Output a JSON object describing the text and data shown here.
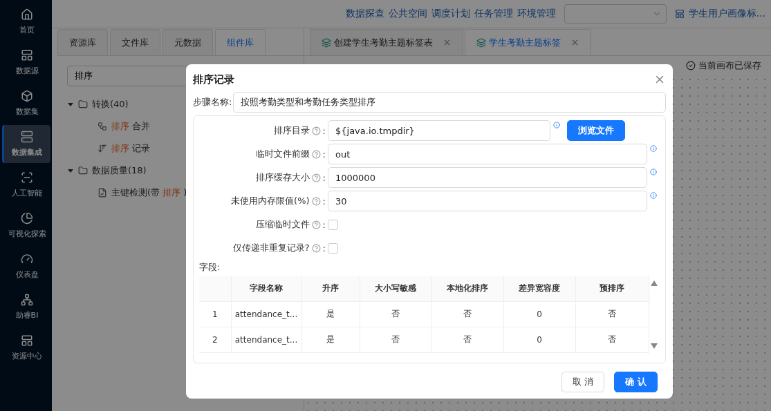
{
  "sidebar": {
    "items": [
      {
        "label": "首页",
        "selected": false
      },
      {
        "label": "数据源",
        "selected": false
      },
      {
        "label": "数据集",
        "selected": false
      },
      {
        "label": "数据集成",
        "selected": true
      },
      {
        "label": "人工智能",
        "selected": false
      },
      {
        "label": "可视化探索",
        "selected": false
      },
      {
        "label": "仪表盘",
        "selected": false
      },
      {
        "label": "助睿BI",
        "selected": false
      },
      {
        "label": "资源中心",
        "selected": false
      }
    ]
  },
  "header": {
    "links": [
      "数据探查",
      "公共空间",
      "调度计划",
      "任务管理",
      "环境管理"
    ],
    "project": "学生用户画像标..."
  },
  "left_panel": {
    "tabs": [
      {
        "label": "资源库",
        "selected": false
      },
      {
        "label": "文件库",
        "selected": false
      },
      {
        "label": "元数据",
        "selected": false
      },
      {
        "label": "组件库",
        "selected": true
      }
    ],
    "search": {
      "value": "排序"
    },
    "tree": [
      {
        "label": "转换(40)",
        "expanded": true,
        "children": [
          {
            "segments": [
              {
                "text": "排序",
                "highlight": true
              },
              {
                "text": " 合并",
                "highlight": false
              }
            ]
          },
          {
            "segments": [
              {
                "text": "排序",
                "highlight": true
              },
              {
                "text": " 记录",
                "highlight": false
              }
            ]
          }
        ]
      },
      {
        "label": "数据质量(18)",
        "expanded": true,
        "children": [
          {
            "segments": [
              {
                "text": "主键检测(带 ",
                "highlight": false
              },
              {
                "text": "排序",
                "highlight": true
              },
              {
                "text": " )",
                "highlight": false
              }
            ]
          }
        ]
      }
    ]
  },
  "editor_tabs": [
    {
      "label": "创建学生考勤主题标签表",
      "selected": false
    },
    {
      "label": "学生考勤主题标签",
      "selected": true
    }
  ],
  "save_status": "当前画布已保存",
  "dialog": {
    "title": "排序记录",
    "step_name": {
      "label": "步骤名称:",
      "value": "按照考勤类型和考勤任务类型排序"
    },
    "separator": ":",
    "fields": [
      {
        "kind": "text",
        "label": "排序目录",
        "value": "${java.io.tmpdir}",
        "button": "浏览文件"
      },
      {
        "kind": "text",
        "label": "临时文件前缀",
        "value": "out"
      },
      {
        "kind": "text",
        "label": "排序缓存大小",
        "value": "1000000"
      },
      {
        "kind": "text",
        "label": "未使用内存限值(%)",
        "value": "30"
      },
      {
        "kind": "checkbox",
        "label": "压缩临时文件",
        "checked": false
      },
      {
        "kind": "checkbox",
        "label": "仅传递非重复记录?",
        "checked": false
      }
    ],
    "fields_label": "字段:",
    "table": {
      "columns": [
        "",
        "字段名称",
        "升序",
        "大小写敏感",
        "本地化排序",
        "差异宽容度",
        "预排序"
      ],
      "rows": [
        [
          "1",
          "attendance_t...",
          "是",
          "否",
          "否",
          "0",
          "否"
        ],
        [
          "2",
          "attendance_t...",
          "是",
          "否",
          "否",
          "0",
          "否"
        ]
      ]
    },
    "buttons": [
      {
        "label": "取 消",
        "kind": "default"
      },
      {
        "label": "确 认",
        "kind": "primary"
      }
    ]
  }
}
